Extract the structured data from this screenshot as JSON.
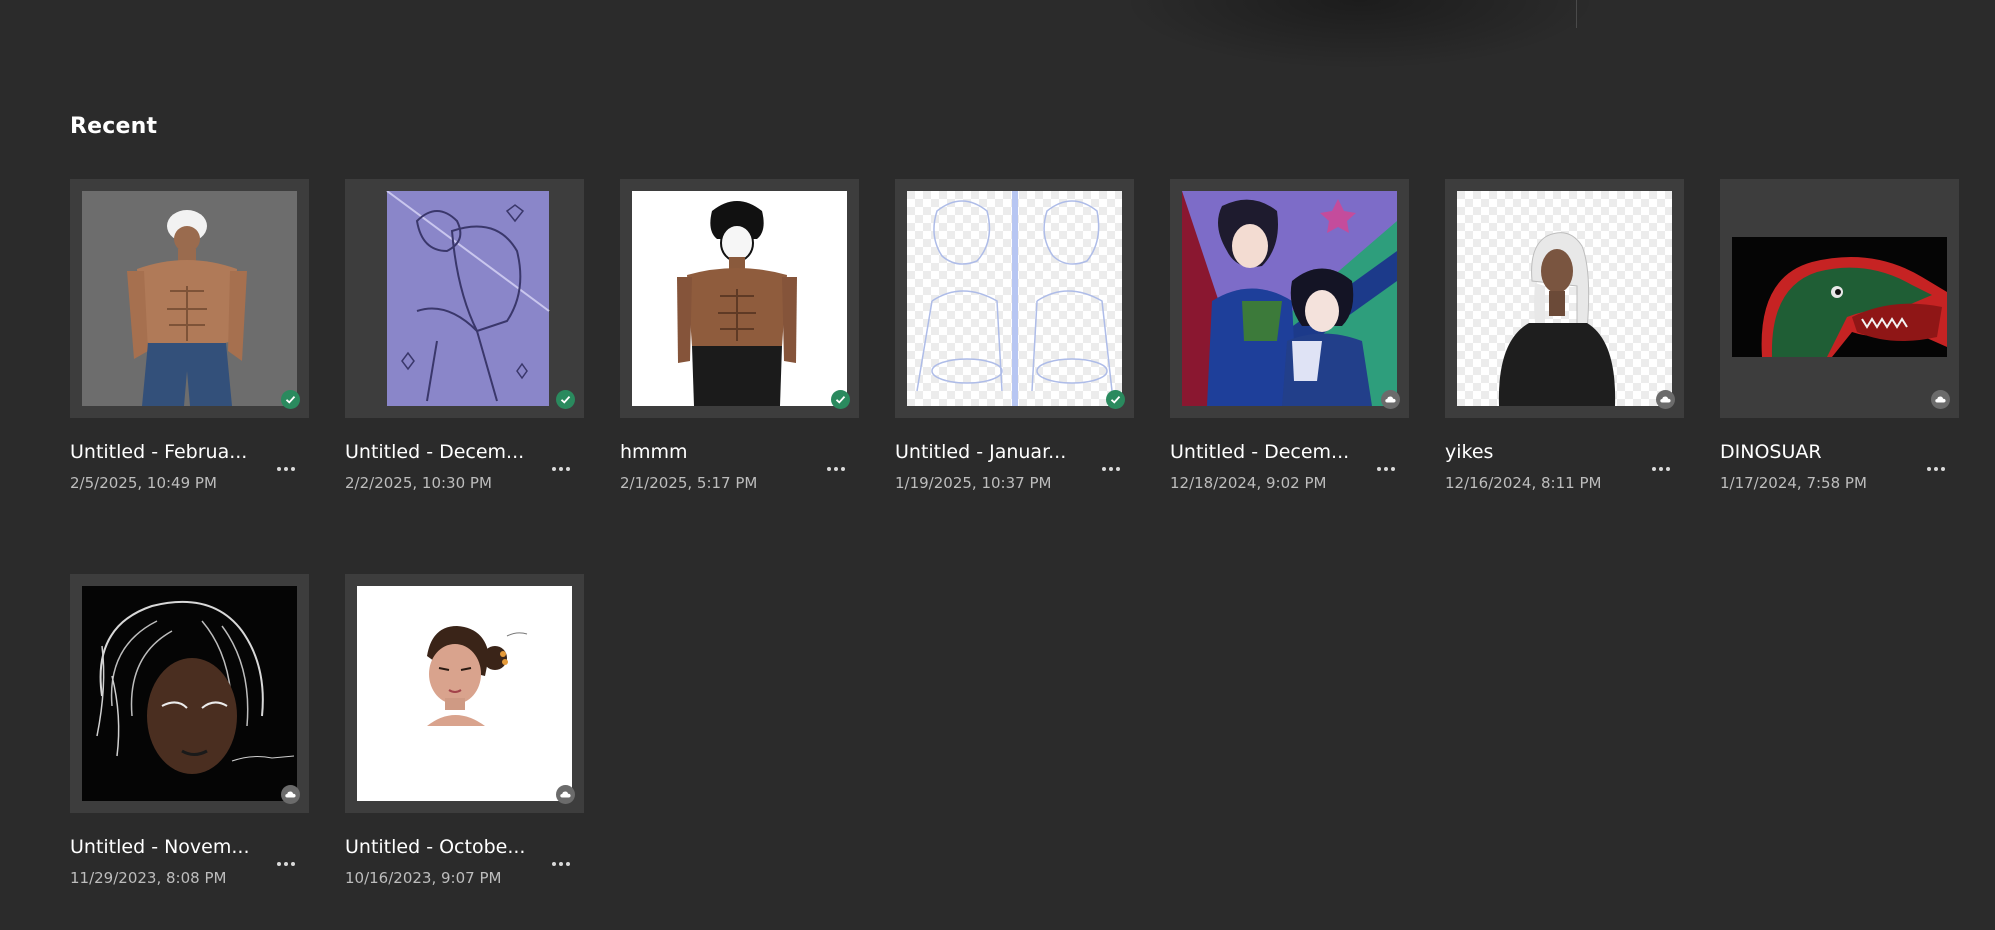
{
  "section": {
    "title": "Recent"
  },
  "files": [
    {
      "title": "Untitled - Februa...",
      "date": "2/5/2025, 10:49 PM",
      "status": "synced"
    },
    {
      "title": "Untitled - Decem...",
      "date": "2/2/2025, 10:30 PM",
      "status": "synced"
    },
    {
      "title": "hmmm",
      "date": "2/1/2025, 5:17 PM",
      "status": "synced"
    },
    {
      "title": "Untitled - Januar...",
      "date": "1/19/2025, 10:37 PM",
      "status": "synced"
    },
    {
      "title": "Untitled - Decem...",
      "date": "12/18/2024, 9:02 PM",
      "status": "cloud"
    },
    {
      "title": "yikes",
      "date": "12/16/2024, 8:11 PM",
      "status": "cloud"
    },
    {
      "title": "DINOSUAR",
      "date": "1/17/2024, 7:58 PM",
      "status": "cloud"
    },
    {
      "title": "Untitled - Novem...",
      "date": "11/29/2023, 8:08 PM",
      "status": "cloud"
    },
    {
      "title": "Untitled - Octobe...",
      "date": "10/16/2023, 9:07 PM",
      "status": "cloud"
    }
  ],
  "colors": {
    "background": "#2b2b2b",
    "card": "#3d3d3d",
    "synced": "#2a8a5e",
    "cloud": "#6b6b6b"
  },
  "icons": {
    "synced": "check-circle-icon",
    "cloud": "cloud-icon",
    "more": "more-options-icon"
  }
}
